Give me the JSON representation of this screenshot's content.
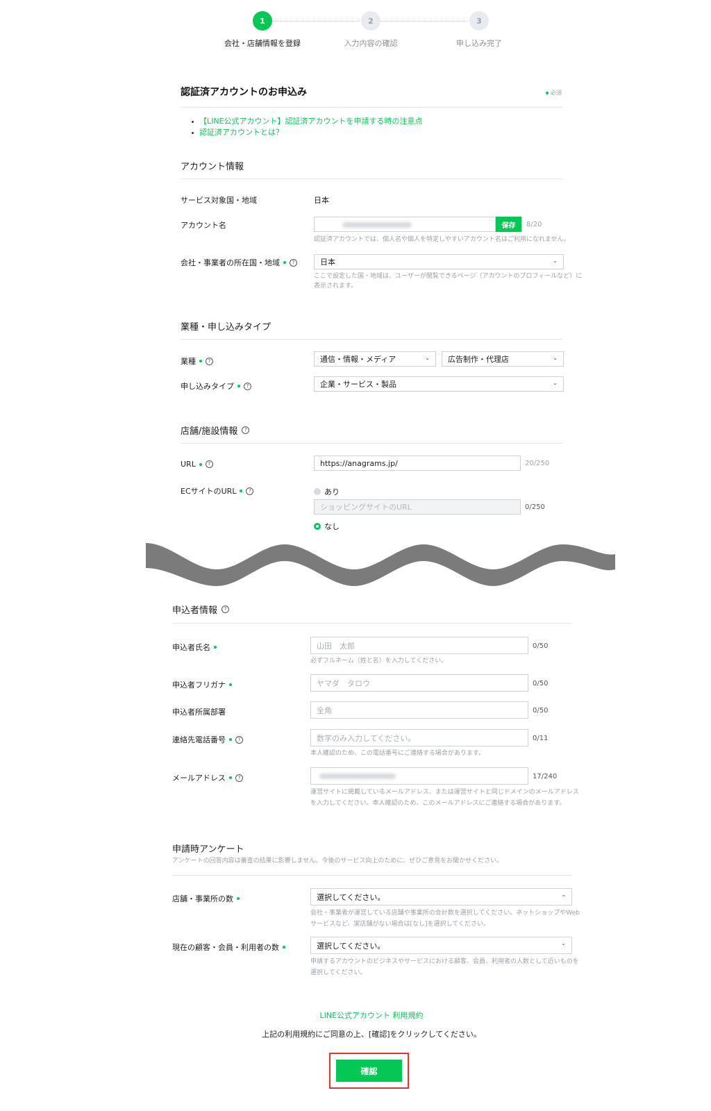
{
  "stepper": {
    "steps": [
      {
        "num": "1",
        "label": "会社・店舗情報を登録"
      },
      {
        "num": "2",
        "label": "入力内容の確認"
      },
      {
        "num": "3",
        "label": "申し込み完了"
      }
    ]
  },
  "header": {
    "title": "認証済アカウントのお申込み",
    "required_note": "必須",
    "links": [
      "【LINE公式アカウント】認証済アカウントを申請する時の注意点",
      "認証済アカウントとは？"
    ]
  },
  "account_info": {
    "section_title": "アカウント情報",
    "service_region_label": "サービス対象国・地域",
    "service_region_value": "日本",
    "account_name_label": "アカウント名",
    "save_label": "保存",
    "account_name_count": "8/20",
    "account_name_help": "認証済アカウントでは、個人名や個人を特定しやすいアカウント名はご利用になれません。",
    "company_region_label": "会社・事業者の所在国・地域",
    "company_region_value": "日本",
    "company_region_help_1": "ここで設定した国・地域は、ユーザーが閲覧できるページ（アカウントのプロフィールなど）に",
    "company_region_help_2": "表示されます。"
  },
  "business": {
    "section_title": "業種・申し込みタイプ",
    "industry_label": "業種",
    "industry_value_1": "通信・情報・メディア",
    "industry_value_2": "広告制作・代理店",
    "type_label": "申し込みタイプ",
    "type_value": "企業・サービス・製品"
  },
  "store": {
    "section_title": "店舗/施設情報",
    "url_label": "URL",
    "url_value": "https://anagrams.jp/",
    "url_count": "20/250",
    "ec_label": "ECサイトのURL",
    "ec_option_yes": "あり",
    "ec_placeholder": "ショッピングサイトのURL",
    "ec_count": "0/250",
    "ec_option_no": "なし"
  },
  "applicant": {
    "section_title": "申込者情報",
    "name_label": "申込者氏名",
    "name_placeholder": "山田　太郎",
    "name_count": "0/50",
    "name_help": "必ずフルネーム（姓と名）を入力してください。",
    "kana_label": "申込者フリガナ",
    "kana_placeholder": "ヤマダ　タロウ",
    "kana_count": "0/50",
    "dept_label": "申込者所属部署",
    "dept_placeholder": "全角",
    "dept_count": "0/50",
    "phone_label": "連絡先電話番号",
    "phone_placeholder": "数字のみ入力してください。",
    "phone_count": "0/11",
    "phone_help": "本人確認のため、この電話番号にご連絡する場合があります。",
    "email_label": "メールアドレス",
    "email_count": "17/240",
    "email_help_1": "運営サイトに掲載しているメールアドレス、または運営サイトと同じドメインのメールアドレス",
    "email_help_2": "を入力してください。本人確認のため、このメールアドレスにご連絡する場合があります。"
  },
  "survey": {
    "section_title": "申請時アンケート",
    "note": "アンケートの回答内容は審査の結果に影響しません。今後のサービス向上のために、ぜひご意見をお聞かせください。",
    "stores_label": "店舗・事業所の数",
    "stores_value": "選択してください。",
    "stores_help_1": "会社・事業者が運営している店舗や事業所の合計数を選択してください。ネットショップやWeb",
    "stores_help_2": "サービスなど、実店舗がない場合は[なし]を選択してください。",
    "customers_label": "現在の顧客・会員・利用者の数",
    "customers_value": "選択してください。",
    "customers_help_1": "申請するアカウントのビジネスやサービスにおける顧客、会員、利用者の人数として近いものを",
    "customers_help_2": "選択してください。"
  },
  "footer": {
    "terms_link": "LINE公式アカウント 利用規約",
    "agree_text": "上記の利用規約にご同意の上、[確認]をクリックしてください。",
    "confirm_label": "確認"
  },
  "icons": {
    "chevron": "chevron-down-icon",
    "help": "question-circle-icon",
    "divider": "wave-divider"
  },
  "colors": {
    "brand_green": "#06c755",
    "highlight_red": "#e53333",
    "wave_gray": "#7b7b7b"
  }
}
